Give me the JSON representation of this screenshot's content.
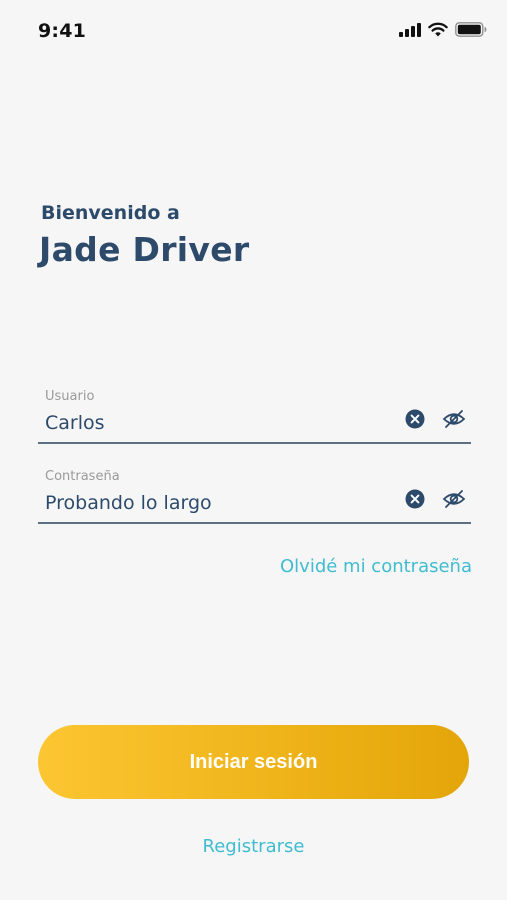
{
  "status_bar": {
    "time": "9:41"
  },
  "header": {
    "welcome": "Bienvenido a",
    "app_name": "Jade Driver"
  },
  "form": {
    "username": {
      "label": "Usuario",
      "value": "Carlos"
    },
    "password": {
      "label": "Contraseña",
      "value": "Probando lo largo"
    },
    "forgot_password": "Olvidé mi contraseña"
  },
  "actions": {
    "login": "Iniciar sesión",
    "register": "Registrarse"
  },
  "colors": {
    "primary_text": "#2d4a6b",
    "link": "#40bcd0",
    "button_start": "#fcc632",
    "button_end": "#e3a50a",
    "background": "#f6f6f6"
  },
  "icons": {
    "signal": "cellular-signal-icon",
    "wifi": "wifi-icon",
    "battery": "battery-icon",
    "clear": "clear-circle-icon",
    "visibility": "eye-off-icon"
  }
}
